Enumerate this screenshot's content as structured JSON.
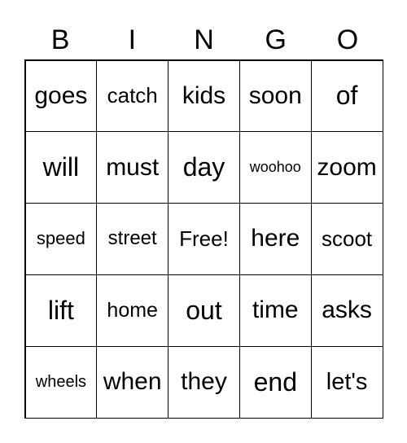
{
  "header": [
    "B",
    "I",
    "N",
    "G",
    "O"
  ],
  "cells": [
    [
      "goes",
      "catch",
      "kids",
      "soon",
      "of"
    ],
    [
      "will",
      "must",
      "day",
      "woohoo",
      "zoom"
    ],
    [
      "speed",
      "street",
      "Free!",
      "here",
      "scoot"
    ],
    [
      "lift",
      "home",
      "out",
      "time",
      "asks"
    ],
    [
      "wheels",
      "when",
      "they",
      "end",
      "let's"
    ]
  ]
}
